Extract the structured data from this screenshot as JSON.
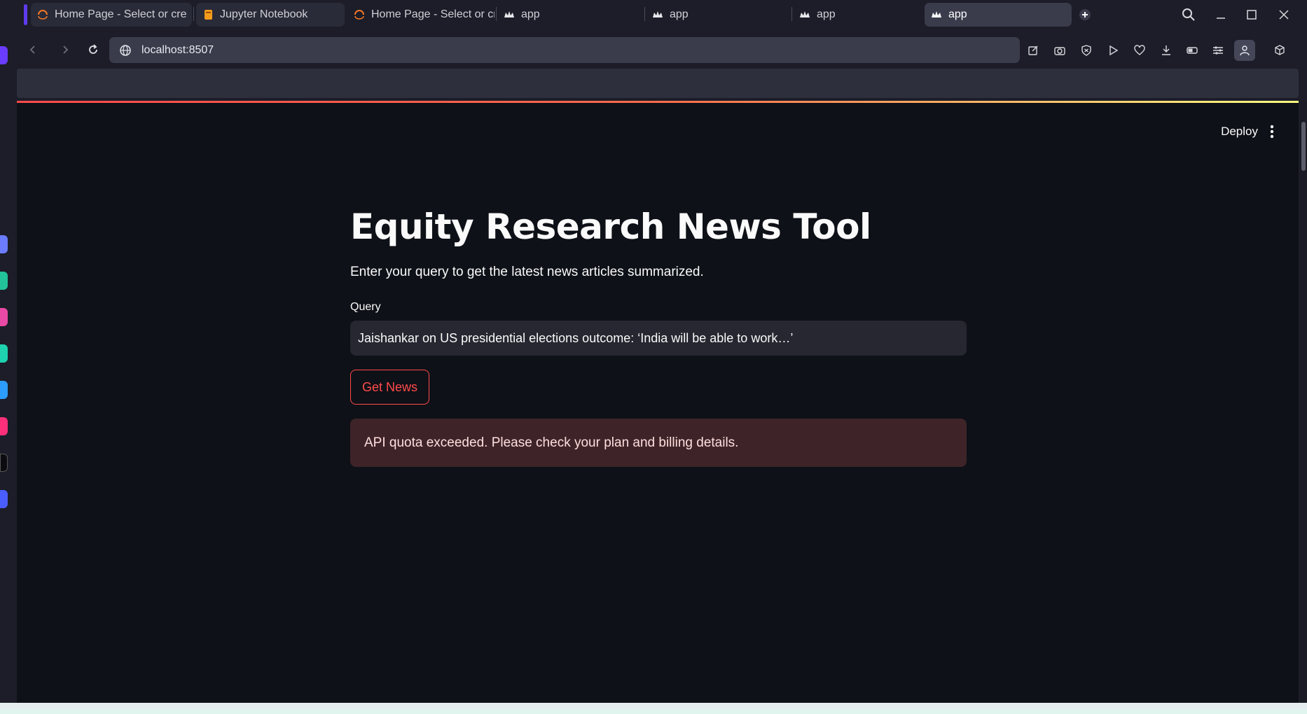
{
  "browser": {
    "tabs": [
      {
        "label": "Home Page - Select or cre",
        "icon": "jupyter-icon"
      },
      {
        "label": "Jupyter Notebook",
        "icon": "notebook-icon"
      },
      {
        "label": "Home Page - Select or cre",
        "icon": "jupyter-icon"
      },
      {
        "label": "app",
        "icon": "streamlit-icon"
      },
      {
        "label": "app",
        "icon": "streamlit-icon"
      },
      {
        "label": "app",
        "icon": "streamlit-icon"
      },
      {
        "label": "app",
        "icon": "streamlit-icon"
      }
    ],
    "address": "localhost:8507",
    "colors": {
      "group_marker": "#5f3bf0",
      "accent_red": "#ff4b4b"
    }
  },
  "app": {
    "deploy_label": "Deploy",
    "title": "Equity Research News Tool",
    "subtitle": "Enter your query to get the latest news articles summarized.",
    "query_label": "Query",
    "query_value": "Jaishankar on US presidential elections outcome: ‘India will be able to work…’",
    "button_label": "Get News",
    "error_message": "API quota exceeded. Please check your plan and billing details.",
    "colors": {
      "background": "#0e1117",
      "input_bg": "#262730",
      "error_bg": "#3e2428",
      "primary": "#ff4b4b"
    }
  }
}
